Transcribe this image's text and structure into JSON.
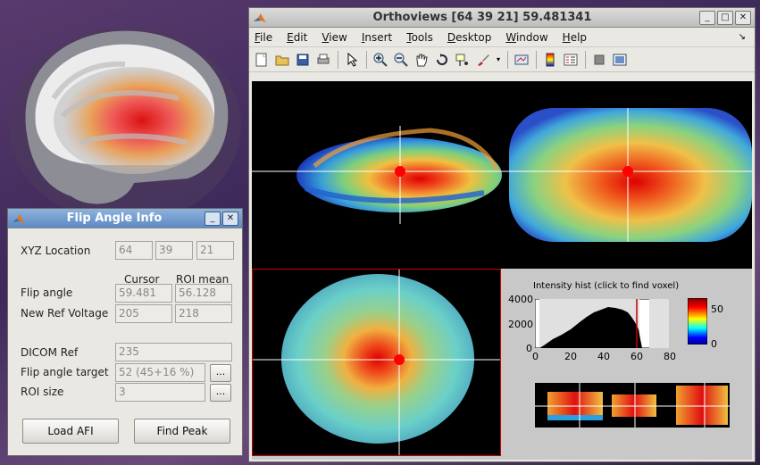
{
  "ortho_window": {
    "title": "Orthoviews [64 39 21] 59.481341",
    "menu": [
      {
        "label": "File",
        "key": "F"
      },
      {
        "label": "Edit",
        "key": "E"
      },
      {
        "label": "View",
        "key": "V"
      },
      {
        "label": "Insert",
        "key": "I"
      },
      {
        "label": "Tools",
        "key": "T"
      },
      {
        "label": "Desktop",
        "key": "D"
      },
      {
        "label": "Window",
        "key": "W"
      },
      {
        "label": "Help",
        "key": "H"
      }
    ],
    "toolbar_icons": [
      "new-figure-icon",
      "open-icon",
      "save-icon",
      "print-icon",
      "edit-plot-icon",
      "zoom-in-icon",
      "zoom-out-icon",
      "pan-icon",
      "rotate-3d-icon",
      "data-cursor-icon",
      "brush-icon",
      "link-plot-icon",
      "colorbar-icon",
      "legend-icon",
      "hide-plot-tools-icon",
      "show-plot-tools-icon"
    ],
    "histogram": {
      "title": "Intensity hist (click to find voxel)",
      "y_ticks": [
        "4000",
        "2000",
        "0"
      ],
      "x_ticks": [
        "0",
        "20",
        "40",
        "60",
        "80"
      ],
      "colorbar_ticks": [
        "50",
        "0"
      ]
    }
  },
  "flip_window": {
    "title": "Flip Angle Info",
    "xyz_label": "XYZ Location",
    "xyz": [
      "64",
      "39",
      "21"
    ],
    "col_cursor": "Cursor",
    "col_roi_mean": "ROI mean",
    "flip_angle_label": "Flip angle",
    "flip_angle_cursor": "59.481",
    "flip_angle_roi": "56.128",
    "ref_voltage_label": "New Ref Voltage",
    "ref_voltage_cursor": "205",
    "ref_voltage_roi": "218",
    "dicom_ref_label": "DICOM Ref",
    "dicom_ref": "235",
    "target_label": "Flip angle target",
    "target": "52 (45+16 %)",
    "roi_size_label": "ROI size",
    "roi_size": "3",
    "ellipsis": "...",
    "load_button": "Load AFI",
    "find_button": "Find Peak"
  },
  "colors": {
    "titlebar_active": "#5d89c4",
    "crosshair": "#ffffff",
    "selected_pane_border": "#d00000",
    "hist_marker": "#cc0000"
  }
}
